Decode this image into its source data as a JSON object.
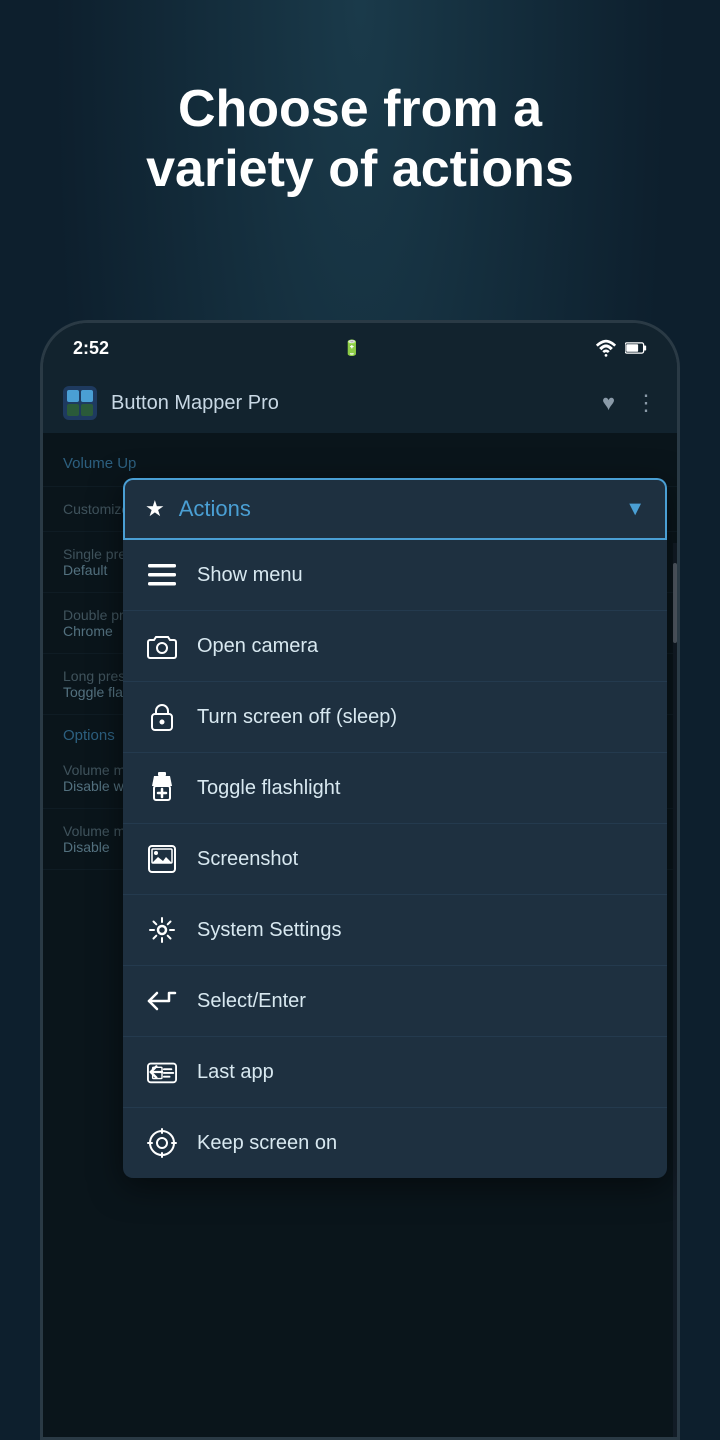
{
  "hero": {
    "line1": "Choose from a",
    "line2": "variety of actions"
  },
  "status_bar": {
    "time": "2:52",
    "wifi": "wifi",
    "battery": "battery"
  },
  "app_bar": {
    "title": "Button Mapper Pro"
  },
  "behind_items": [
    {
      "label": "Volu...",
      "sublabel": "",
      "type": "header"
    },
    {
      "label": "Cus...",
      "sublabel": "",
      "toggle": true,
      "type": "row"
    },
    {
      "label": "Sin...",
      "sublabel": "Def...",
      "type": "row"
    },
    {
      "label": "Dou...",
      "sublabel": "Chr...",
      "dot": "yellow",
      "type": "row"
    },
    {
      "label": "Lon...",
      "sublabel": "Tog...",
      "type": "row"
    },
    {
      "label": "Opt...",
      "type": "options-header"
    },
    {
      "label": "Vol...",
      "sublabel": "Dis... sho...",
      "toggle": true,
      "type": "row"
    },
    {
      "label": "Vol...",
      "sublabel": "Dis...",
      "toggle": true,
      "type": "row"
    }
  ],
  "dropdown": {
    "title": "Actions",
    "chevron": "▼",
    "items": [
      {
        "id": "show-menu",
        "icon": "menu",
        "label": "Show menu"
      },
      {
        "id": "open-camera",
        "icon": "camera",
        "label": "Open camera"
      },
      {
        "id": "turn-screen-off",
        "icon": "lock",
        "label": "Turn screen off (sleep)"
      },
      {
        "id": "toggle-flashlight",
        "icon": "flashlight",
        "label": "Toggle flashlight"
      },
      {
        "id": "screenshot",
        "icon": "screenshot",
        "label": "Screenshot"
      },
      {
        "id": "system-settings",
        "icon": "settings",
        "label": "System Settings"
      },
      {
        "id": "select-enter",
        "icon": "enter",
        "label": "Select/Enter"
      },
      {
        "id": "last-app",
        "icon": "last-app",
        "label": "Last app"
      },
      {
        "id": "keep-screen-on",
        "icon": "screen-on",
        "label": "Keep screen on"
      }
    ]
  }
}
